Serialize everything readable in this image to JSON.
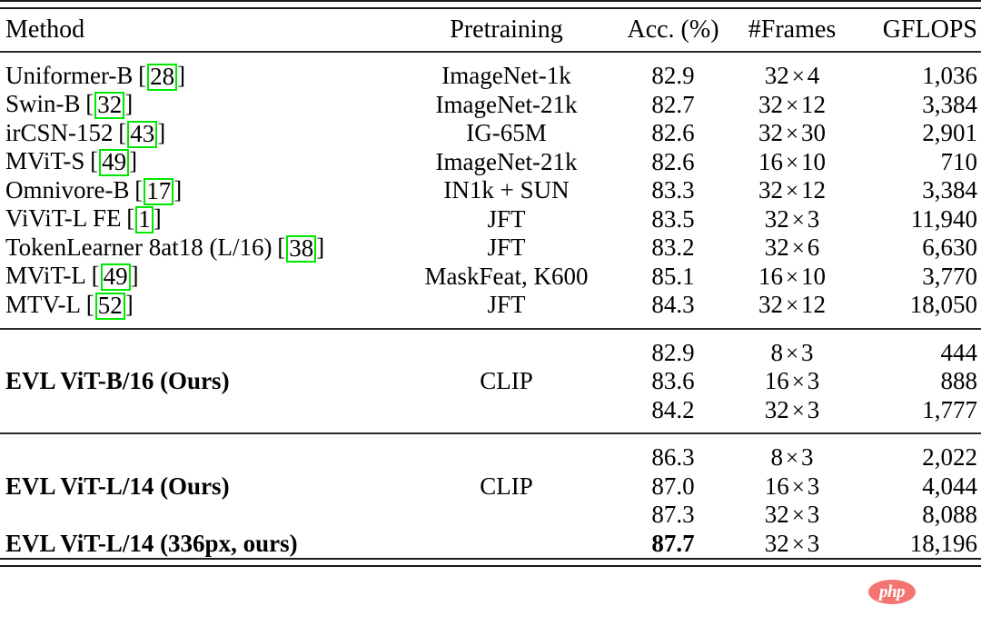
{
  "table": {
    "columns": [
      {
        "key": "method",
        "label": "Method",
        "align": "left"
      },
      {
        "key": "pretrain",
        "label": "Pretraining",
        "align": "center"
      },
      {
        "key": "acc",
        "label": "Acc. (%)",
        "align": "center"
      },
      {
        "key": "frames",
        "label": "#Frames",
        "align": "center"
      },
      {
        "key": "gflops",
        "label": "GFLOPS",
        "align": "right"
      }
    ],
    "rows_top": [
      {
        "method": "Uniformer-B",
        "cite": "28",
        "pretrain": "ImageNet-1k",
        "acc": "82.9",
        "frames_n": "32",
        "frames_v": "4",
        "gflops": "1,036"
      },
      {
        "method": "Swin-B",
        "cite": "32",
        "pretrain": "ImageNet-21k",
        "acc": "82.7",
        "frames_n": "32",
        "frames_v": "12",
        "gflops": "3,384"
      },
      {
        "method": "irCSN-152",
        "cite": "43",
        "pretrain": "IG-65M",
        "acc": "82.6",
        "frames_n": "32",
        "frames_v": "30",
        "gflops": "2,901"
      },
      {
        "method": "MViT-S",
        "cite": "49",
        "pretrain": "ImageNet-21k",
        "acc": "82.6",
        "frames_n": "16",
        "frames_v": "10",
        "gflops": "710"
      },
      {
        "method": "Omnivore-B",
        "cite": "17",
        "pretrain": "IN1k + SUN",
        "acc": "83.3",
        "frames_n": "32",
        "frames_v": "12",
        "gflops": "3,384"
      },
      {
        "method": "ViViT-L FE",
        "cite": "1",
        "pretrain": "JFT",
        "acc": "83.5",
        "frames_n": "32",
        "frames_v": "3",
        "gflops": "11,940"
      },
      {
        "method": "TokenLearner 8at18 (L/16)",
        "cite": "38",
        "pretrain": "JFT",
        "acc": "83.2",
        "frames_n": "32",
        "frames_v": "6",
        "gflops": "6,630"
      },
      {
        "method": "MViT-L",
        "cite": "49",
        "pretrain": "MaskFeat, K600",
        "acc": "85.1",
        "frames_n": "16",
        "frames_v": "10",
        "gflops": "3,770"
      },
      {
        "method": "MTV-L",
        "cite": "52",
        "pretrain": "JFT",
        "acc": "84.3",
        "frames_n": "32",
        "frames_v": "12",
        "gflops": "18,050"
      }
    ],
    "group_b16": {
      "method": "EVL ViT-B/16 (Ours)",
      "pretrain": "CLIP",
      "rows": [
        {
          "acc": "82.9",
          "frames_n": "8",
          "frames_v": "3",
          "gflops": "444"
        },
        {
          "acc": "83.6",
          "frames_n": "16",
          "frames_v": "3",
          "gflops": "888"
        },
        {
          "acc": "84.2",
          "frames_n": "32",
          "frames_v": "3",
          "gflops": "1,777"
        }
      ]
    },
    "group_l14": {
      "method": "EVL ViT-L/14 (Ours)",
      "pretrain": "CLIP",
      "rows": [
        {
          "acc": "86.3",
          "frames_n": "8",
          "frames_v": "3",
          "gflops": "2,022"
        },
        {
          "acc": "87.0",
          "frames_n": "16",
          "frames_v": "3",
          "gflops": "4,044"
        },
        {
          "acc": "87.3",
          "frames_n": "32",
          "frames_v": "3",
          "gflops": "8,088"
        }
      ]
    },
    "row_l14_336": {
      "method": "EVL ViT-L/14 (336px, ours)",
      "pretrain": "",
      "acc": "87.7",
      "frames_n": "32",
      "frames_v": "3",
      "gflops": "18,196"
    },
    "symbols": {
      "times": "×",
      "bracket_open": "[",
      "bracket_close": "]"
    },
    "colors": {
      "citation_box": "#00e800",
      "rule": "#1a1a1a",
      "text": "#000000",
      "watermark_bg": "#f2635f"
    }
  },
  "watermark": {
    "text": "php"
  }
}
